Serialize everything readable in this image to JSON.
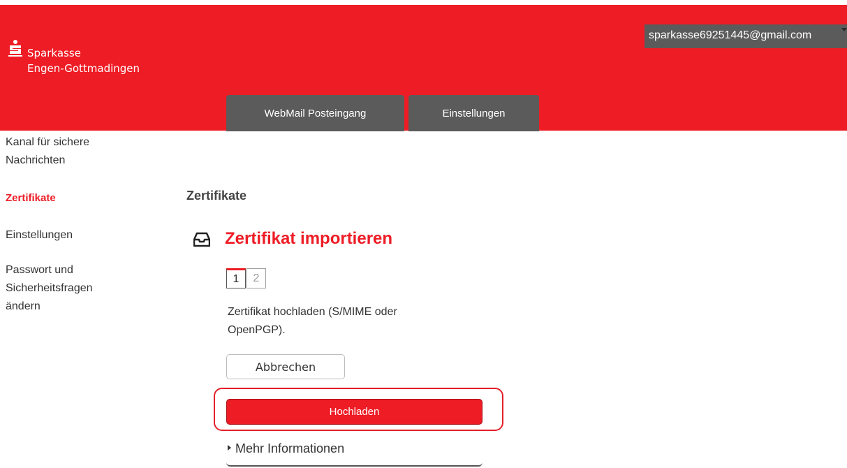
{
  "brand": {
    "line1": "Sparkasse",
    "line2": "Engen-Gottmadingen",
    "logo_icon": "sparkasse-s-icon",
    "color": "#ee1c25"
  },
  "user": {
    "email": "sparkasse69251445@gmail.com",
    "menu_icon": "caret-down-icon"
  },
  "tabs": [
    {
      "label": "WebMail Posteingang"
    },
    {
      "label": "Einstellungen"
    }
  ],
  "sidebar": {
    "items": [
      {
        "label": "Kanal für sichere Nachrichten"
      },
      {
        "label": "Zertifikate",
        "active": true
      },
      {
        "label": "Einstellungen"
      },
      {
        "label": "Passwort und Sicherheitsfragen ändern"
      }
    ]
  },
  "main": {
    "section_title": "Zertifikate",
    "import_title": "Zertifikat importieren",
    "import_icon": "inbox-tray-icon",
    "steps": [
      "1",
      "2"
    ],
    "current_step": 1,
    "description": "Zertifikat hochladen (S/MIME oder OpenPGP).",
    "cancel_label": "Abbrechen",
    "upload_label": "Hochladen",
    "more_info_label": "Mehr Informationen"
  }
}
